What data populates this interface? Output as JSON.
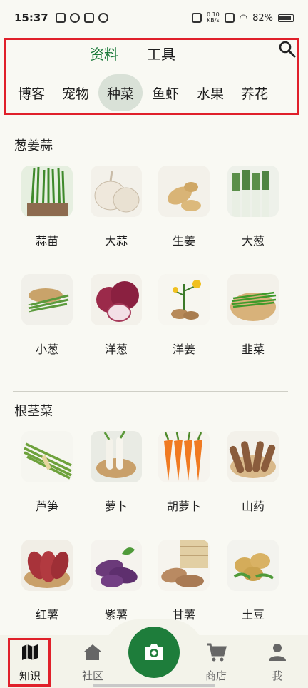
{
  "status_bar": {
    "time": "15:37",
    "speed_top": "0.10",
    "speed_bottom": "KB/s",
    "battery": "82%"
  },
  "header": {
    "tabs": [
      "资料",
      "工具"
    ],
    "active_tab": "资料",
    "categories": [
      "博客",
      "宠物",
      "种菜",
      "鱼虾",
      "水果",
      "养花"
    ],
    "active_category": "种菜"
  },
  "sections": [
    {
      "title": "葱姜蒜",
      "items": [
        "蒜苗",
        "大蒜",
        "生姜",
        "大葱",
        "小葱",
        "洋葱",
        "洋姜",
        "韭菜"
      ]
    },
    {
      "title": "根茎菜",
      "items": [
        "芦笋",
        "萝卜",
        "胡萝卜",
        "山药",
        "红薯",
        "紫薯",
        "甘薯",
        "土豆"
      ]
    }
  ],
  "bottom_nav": {
    "items": [
      "知识",
      "社区",
      "商店",
      "我"
    ],
    "active": "知识"
  },
  "colors": {
    "accent": "#1b7a3a",
    "highlight": "#e0202a",
    "active_pill": "#d9e1d7",
    "background": "#f9f9f3"
  }
}
